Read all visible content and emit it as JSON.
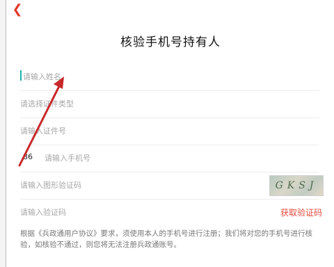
{
  "header": {
    "back_icon": "chevron-left-icon",
    "title": "核验手机号持有人"
  },
  "form": {
    "name_placeholder": "请输入姓名",
    "id_type_placeholder": "请选择证件类型",
    "id_number_placeholder": "请输入证件号",
    "phone_prefix": "86",
    "phone_placeholder": "请输入手机号",
    "captcha_placeholder": "请输入图形验证码",
    "captcha_text": "GKSJ",
    "sms_placeholder": "请输入验证码",
    "get_code_label": "获取验证码"
  },
  "notice": "根据《兵政通用户协议》要求，须使用本人的手机号进行注册；我们将对您的手机号进行核验，如核验不通过，则您将无法注册兵政通账号。",
  "colors": {
    "accent": "#e24a3c",
    "cursor": "#19b3a6",
    "annotation_arrow": "#c8282a"
  }
}
